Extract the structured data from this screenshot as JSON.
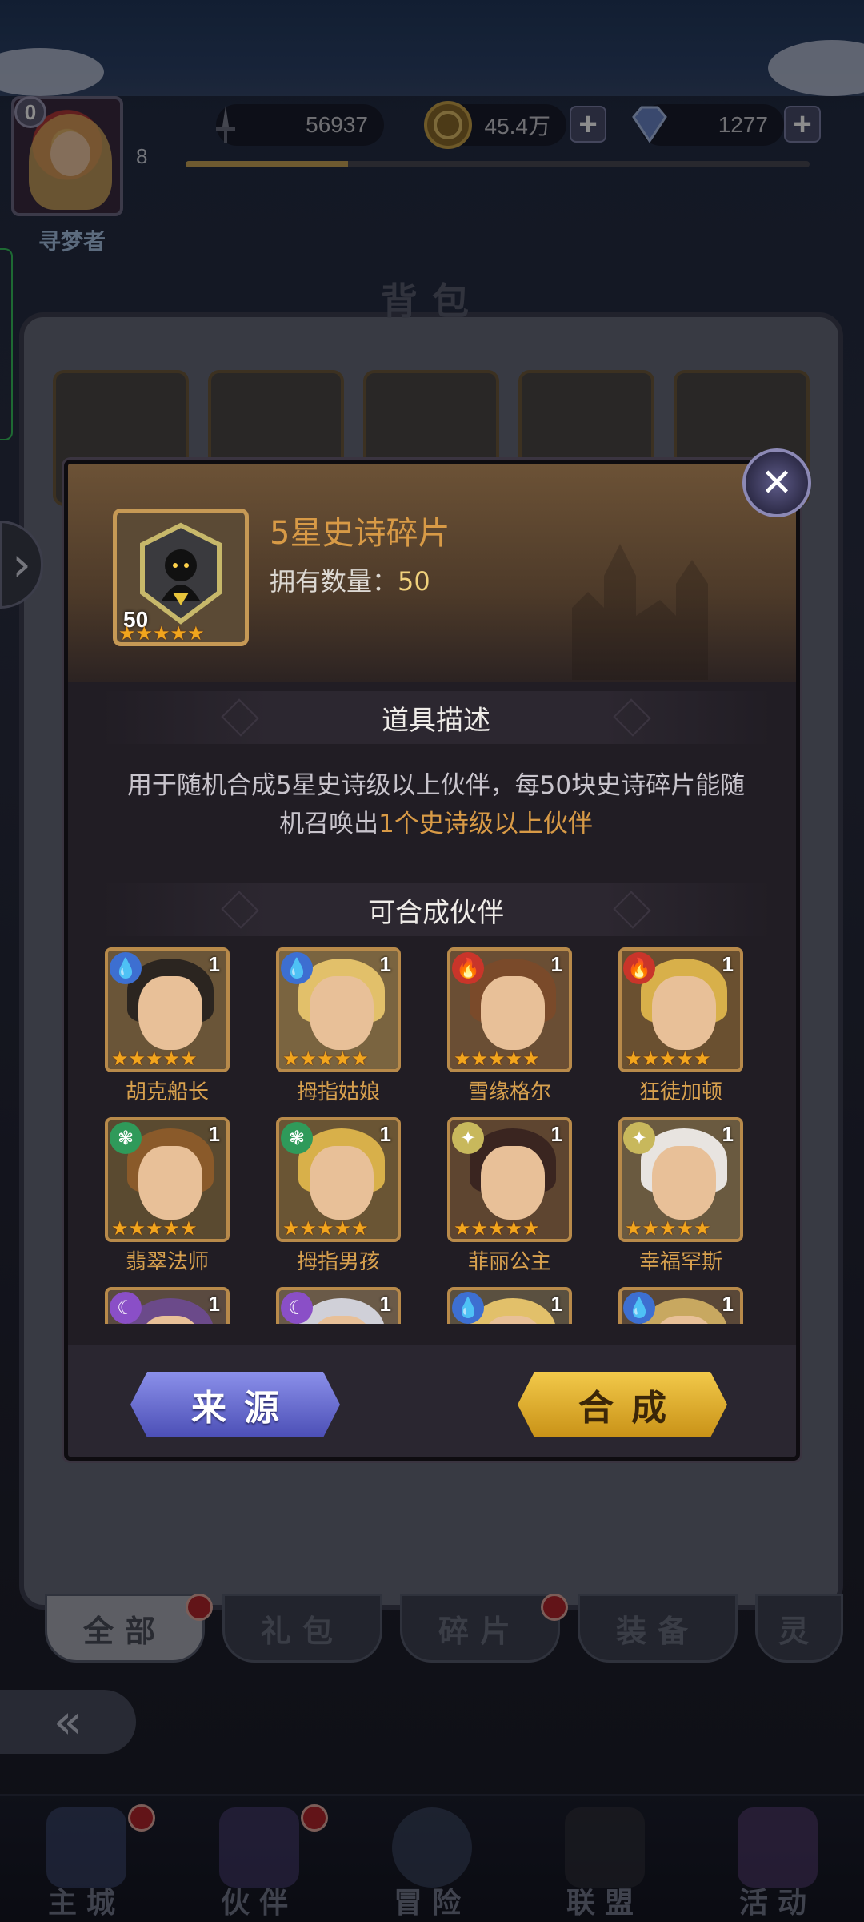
{
  "hud": {
    "vip_level": "0",
    "player_level": "8",
    "player_name": "寻梦者",
    "xp_progress": 0.26,
    "power": "56937",
    "gold": "45.4万",
    "diamonds": "1277",
    "plus": "+"
  },
  "bag": {
    "title": "背包",
    "tabs": [
      "全部",
      "礼包",
      "碎片",
      "装备",
      "灵"
    ],
    "active_tab": 0
  },
  "modal": {
    "item_name": "5星史诗碎片",
    "owned_label": "拥有数量：",
    "owned_value": "50",
    "item_count": "50",
    "item_stars": 5,
    "desc_header": "道具描述",
    "desc_text": "用于随机合成5星史诗级以上伙伴，每50块史诗碎片能随机召唤出",
    "desc_highlight": "1个史诗级以上伙伴",
    "partners_header": "可合成伙伴",
    "partners": [
      {
        "name": "胡克船长",
        "count": "1",
        "element": "water",
        "elem_color": "#3d6fd1",
        "elem_glyph": "💧"
      },
      {
        "name": "拇指姑娘",
        "count": "1",
        "element": "water",
        "elem_color": "#3d6fd1",
        "elem_glyph": "💧"
      },
      {
        "name": "雪缘格尔",
        "count": "1",
        "element": "fire",
        "elem_color": "#c9352a",
        "elem_glyph": "🔥"
      },
      {
        "name": "狂徒加顿",
        "count": "1",
        "element": "fire",
        "elem_color": "#c9352a",
        "elem_glyph": "🔥"
      },
      {
        "name": "翡翠法师",
        "count": "1",
        "element": "wind",
        "elem_color": "#2f9a5a",
        "elem_glyph": "❃"
      },
      {
        "name": "拇指男孩",
        "count": "1",
        "element": "wind",
        "elem_color": "#2f9a5a",
        "elem_glyph": "❃"
      },
      {
        "name": "菲丽公主",
        "count": "1",
        "element": "light",
        "elem_color": "#c8b85c",
        "elem_glyph": "✦"
      },
      {
        "name": "幸福罕斯",
        "count": "1",
        "element": "light",
        "elem_color": "#c8b85c",
        "elem_glyph": "✦"
      },
      {
        "name": "",
        "count": "1",
        "element": "dark",
        "elem_color": "#8a4fc7",
        "elem_glyph": "☾"
      },
      {
        "name": "",
        "count": "1",
        "element": "dark",
        "elem_color": "#8a4fc7",
        "elem_glyph": "☾"
      },
      {
        "name": "",
        "count": "1",
        "element": "water",
        "elem_color": "#3d6fd1",
        "elem_glyph": "💧"
      },
      {
        "name": "",
        "count": "1",
        "element": "water",
        "elem_color": "#3d6fd1",
        "elem_glyph": "💧"
      }
    ],
    "source_button": "来源",
    "compose_button": "合成",
    "close_glyph": "✕"
  },
  "nav": {
    "items": [
      {
        "label": "主城",
        "icon": "castle-icon",
        "dot": true
      },
      {
        "label": "伙伴",
        "icon": "wizard-hat-icon",
        "dot": true
      },
      {
        "label": "冒险",
        "icon": "compass-icon",
        "dot": false
      },
      {
        "label": "联盟",
        "icon": "lock-icon",
        "dot": false
      },
      {
        "label": "活动",
        "icon": "cards-icon",
        "dot": false
      }
    ]
  },
  "colors": {
    "accent_gold": "#d89a46",
    "star": "#f2a51d",
    "source_button": "#4c4fb6",
    "compose_button": "#c99217"
  }
}
